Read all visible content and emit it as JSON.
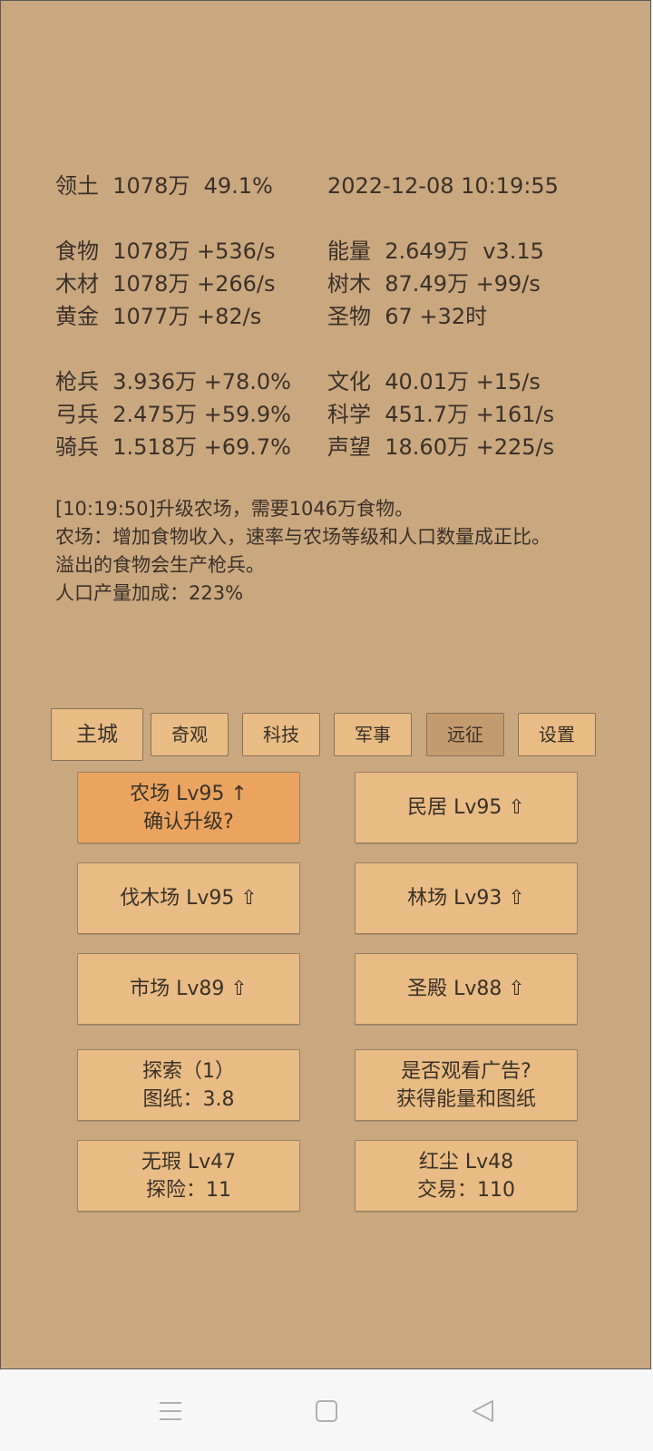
{
  "stats": {
    "territory_label": "领土",
    "territory_value": "1078万  49.1%",
    "datetime": "2022-12-08 10:19:55",
    "food_label": "食物",
    "food_value": "1078万 +536/s",
    "energy_label": "能量",
    "energy_value": "2.649万  v3.15",
    "wood_label": "木材",
    "wood_value": "1078万 +266/s",
    "trees_label": "树木",
    "trees_value": "87.49万 +99/s",
    "gold_label": "黄金",
    "gold_value": "1077万 +82/s",
    "relic_label": "圣物",
    "relic_value": "67 +32时",
    "spearman_label": "枪兵",
    "spearman_value": "3.936万 +78.0%",
    "culture_label": "文化",
    "culture_value": "40.01万 +15/s",
    "archer_label": "弓兵",
    "archer_value": "2.475万 +59.9%",
    "science_label": "科学",
    "science_value": "451.7万 +161/s",
    "cavalry_label": "骑兵",
    "cavalry_value": "1.518万 +69.7%",
    "prestige_label": "声望",
    "prestige_value": "18.60万 +225/s"
  },
  "log": [
    "[10:19:50]升级农场，需要1046万食物。",
    "农场：增加食物收入，速率与农场等级和人口数量成正比。",
    "溢出的食物会生产枪兵。",
    "人口产量加成：223%"
  ],
  "tabs": [
    "主城",
    "奇观",
    "科技",
    "军事",
    "远征",
    "设置"
  ],
  "buttons": {
    "farm_line1": "农场 Lv95 ↑",
    "farm_line2": "确认升级?",
    "house": "民居 Lv95 ⇧",
    "lumber": "伐木场 Lv95 ⇧",
    "forest": "林场 Lv93 ⇧",
    "market": "市场 Lv89 ⇧",
    "temple": "圣殿 Lv88 ⇧",
    "explore_line1": "探索（1）",
    "explore_line2": "图纸：3.8",
    "ad_line1": "是否观看广告?",
    "ad_line2": "获得能量和图纸",
    "flawless_line1": "无瑕 Lv47",
    "flawless_line2": "探险：11",
    "redearth_line1": "红尘 Lv48",
    "redearth_line2": "交易：110"
  },
  "nav": {
    "menu": "menu-icon",
    "home": "square-home-icon",
    "back": "triangle-back-icon"
  },
  "colors": {
    "background": "#c9a880",
    "button": "#e8bc84",
    "button_highlight": "#eba45f",
    "tab_selected": "#c29b6e"
  }
}
